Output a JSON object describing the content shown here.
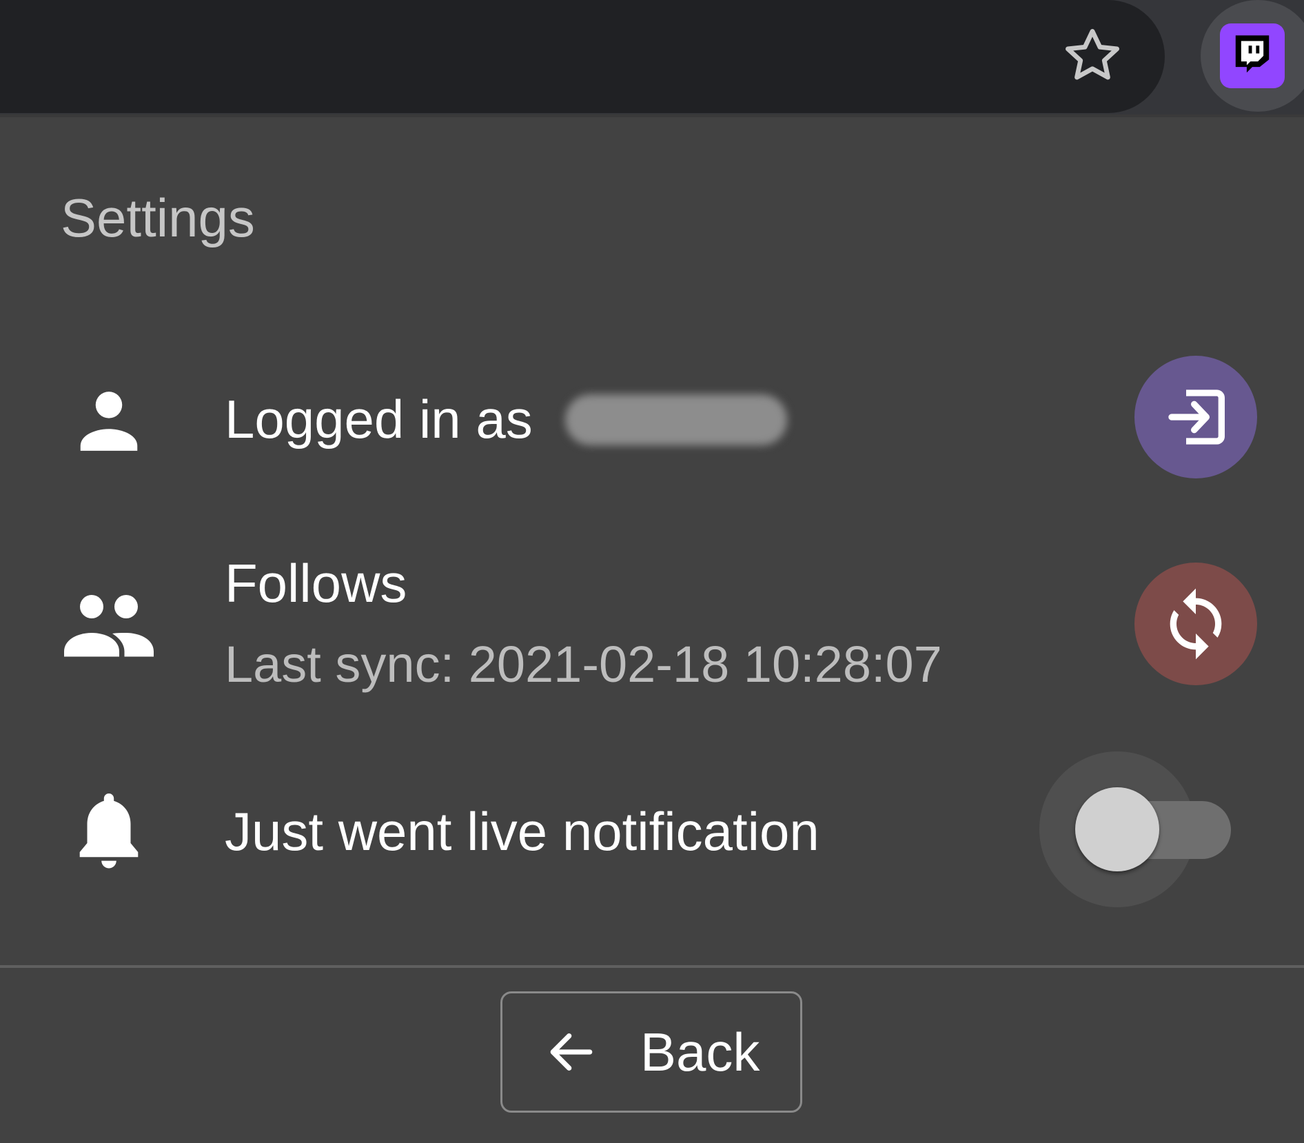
{
  "browser": {
    "bookmark_icon": "star-outline-icon",
    "extension_icon": "twitch-logo-icon",
    "extension_color": "#9146ff"
  },
  "settings": {
    "title": "Settings",
    "account": {
      "icon": "person-icon",
      "label": "Logged in as",
      "username_redacted": true,
      "action_icon": "login-icon",
      "action_color": "#675890"
    },
    "follows": {
      "icon": "people-icon",
      "label": "Follows",
      "last_sync": "Last sync: 2021-02-18 10:28:07",
      "action_icon": "sync-icon",
      "action_color": "#7d4b49"
    },
    "notification": {
      "icon": "bell-icon",
      "label": "Just went live notification",
      "enabled": false
    }
  },
  "footer": {
    "back_icon": "arrow-left-icon",
    "back_label": "Back"
  }
}
